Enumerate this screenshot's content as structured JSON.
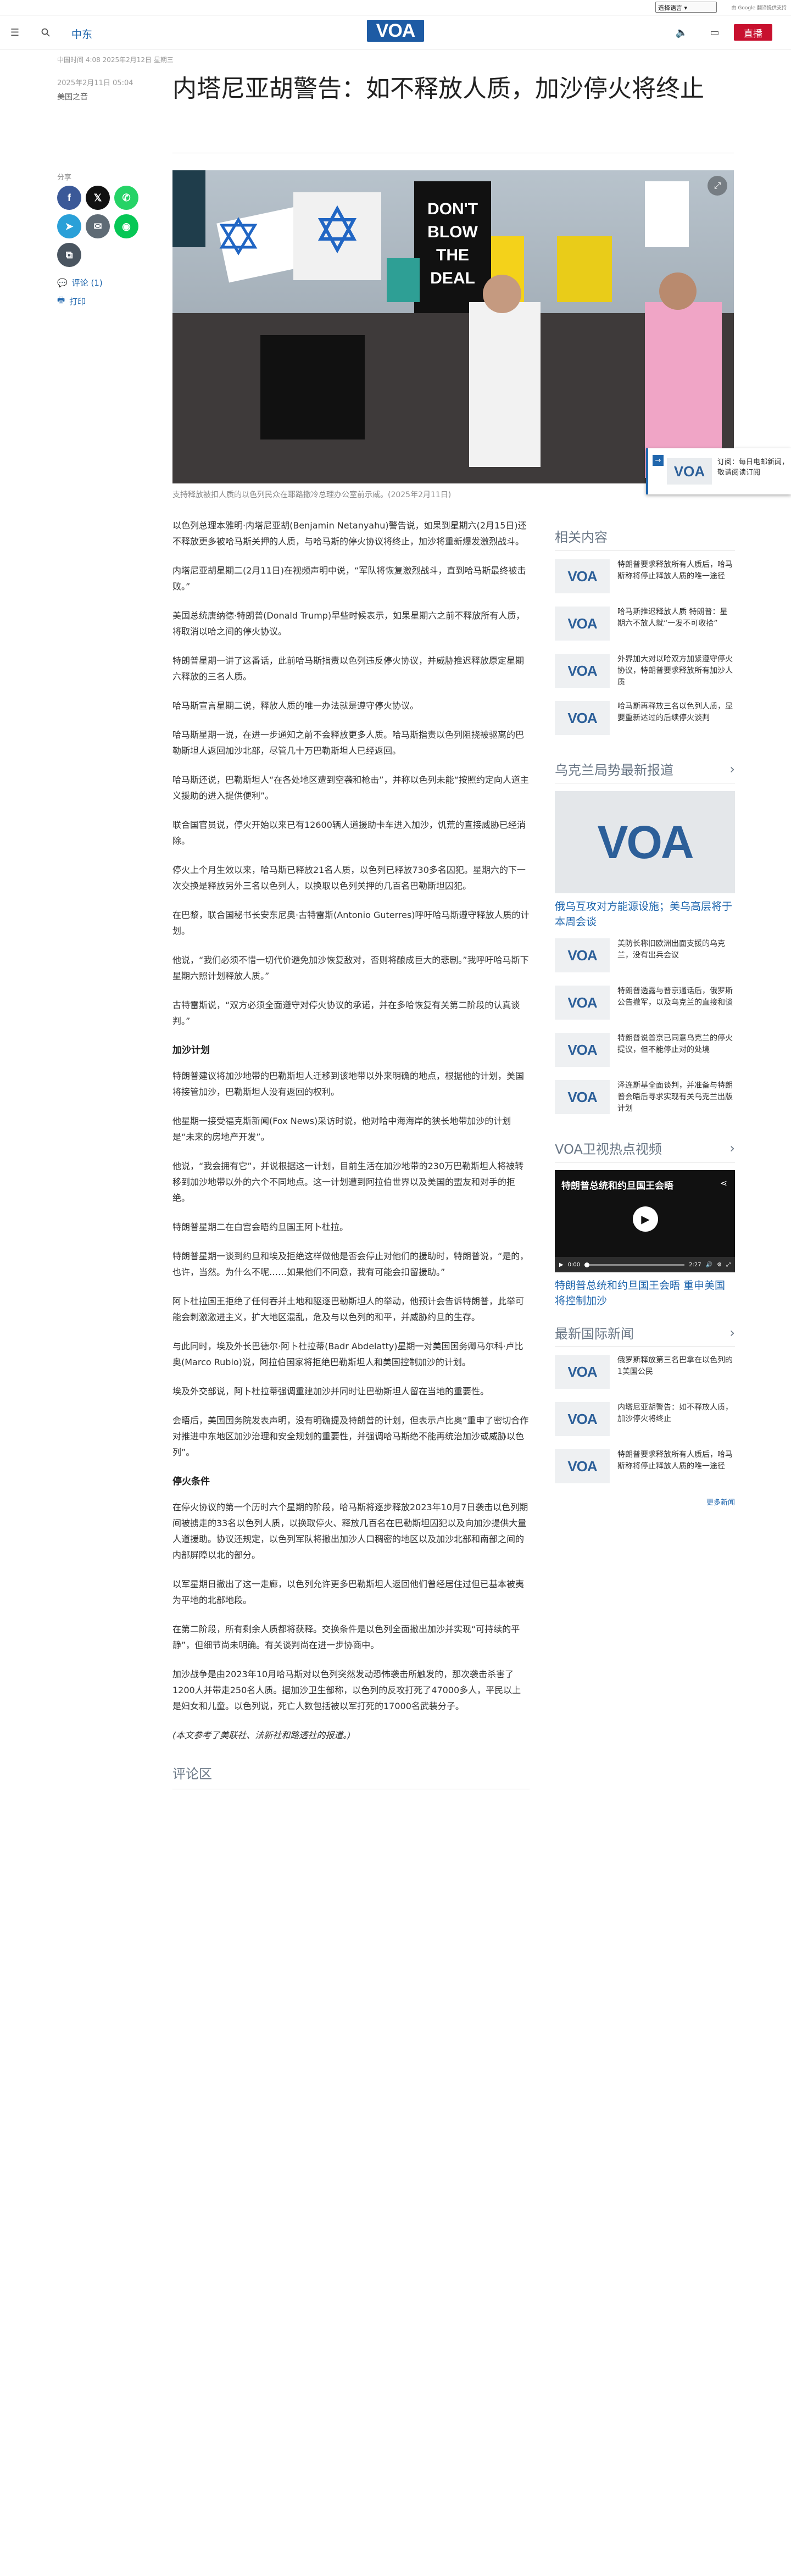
{
  "topbar": {
    "language_select": "选择语言",
    "translate_credit": "由 Google 翻译提供支持"
  },
  "header": {
    "section": "中东",
    "logo": "VOA",
    "live_label": "直播"
  },
  "article": {
    "meta_line": "中国时间 4:08 2025年2月12日 星期三",
    "date": "2025年2月11日 05:04",
    "author": "美国之音",
    "title": "内塔尼亚胡警告：如不释放人质，加沙停火将终止",
    "share_label": "分享",
    "comments_label": "评论 (1)",
    "print_label": "打印",
    "image_texts": {
      "sign1": "DON'T BLOW THE DEAL"
    },
    "caption": "支持释放被扣人质的以色列民众在耶路撒冷总理办公室前示威。(2025年2月11日)",
    "paragraphs": [
      "以色列总理本雅明·内塔尼亚胡(Benjamin Netanyahu)警告说，如果到星期六(2月15日)还不释放更多被哈马斯关押的人质，与哈马斯的停火协议将终止，加沙将重新爆发激烈战斗。",
      "内塔尼亚胡星期二(2月11日)在视频声明中说，“军队将恢复激烈战斗，直到哈马斯最终被击败。”",
      "美国总统唐纳德·特朗普(Donald Trump)早些时候表示，如果星期六之前不释放所有人质，将取消以哈之间的停火协议。",
      "特朗普星期一讲了这番话，此前哈马斯指责以色列违反停火协议，并威胁推迟释放原定星期六释放的三名人质。",
      "哈马斯宣言星期二说，释放人质的唯一办法就是遵守停火协议。",
      "哈马斯星期一说，在进一步通知之前不会释放更多人质。哈马斯指责以色列阻挠被驱离的巴勒斯坦人返回加沙北部，尽管几十万巴勒斯坦人已经返回。",
      "哈马斯还说，巴勒斯坦人“在各处地区遭到空袭和枪击”，并称以色列未能“按照约定向人道主义援助的进入提供便利”。",
      "联合国官员说，停火开始以来已有12600辆人道援助卡车进入加沙，饥荒的直接威胁已经消除。",
      "停火上个月生效以来，哈马斯已释放21名人质，以色列已释放730多名囚犯。星期六的下一次交换是释放另外三名以色列人，以换取以色列关押的几百名巴勒斯坦囚犯。",
      "在巴黎，联合国秘书长安东尼奥·古特雷斯(Antonio Guterres)呼吁哈马斯遵守释放人质的计划。",
      "他说，“我们必须不惜一切代价避免加沙恢复敌对，否则将酿成巨大的悲剧。”我呼吁哈马斯下星期六照计划释放人质。”",
      "古特雷斯说，“双方必须全面遵守对停火协议的承诺，并在多哈恢复有关第二阶段的认真谈判。”"
    ],
    "subhead1": "加沙计划",
    "paragraphs2": [
      "特朗普建议将加沙地带的巴勒斯坦人迁移到该地带以外来明确的地点，根据他的计划，美国将接管加沙，巴勒斯坦人没有返回的权利。",
      "他星期一接受福克斯新闻(Fox News)采访时说，他对哈中海海岸的狭长地带加沙的计划是“未来的房地产开发”。",
      "他说，“我会拥有它”，并说根据这一计划，目前生活在加沙地带的230万巴勒斯坦人将被转移到加沙地带以外的六个不同地点。这一计划遭到阿拉伯世界以及美国的盟友和对手的拒绝。",
      "特朗普星期二在白宫会晤约旦国王阿卜杜拉。",
      "特朗普星期一谈到约旦和埃及拒绝这样做他是否会停止对他们的援助时，特朗普说，“是的，也许，当然。为什么不呢……如果他们不同意，我有可能会扣留援助。”",
      "阿卜杜拉国王拒绝了任何吞并土地和驱逐巴勒斯坦人的举动，他预计会告诉特朗普，此举可能会刺激激进主义，扩大地区混乱，危及与以色列的和平，并威胁约旦的生存。",
      "与此同时，埃及外长巴德尔·阿卜杜拉蒂(Badr Abdelatty)星期一对美国国务卿马尔科·卢比奥(Marco Rubio)说，阿拉伯国家将拒绝巴勒斯坦人和美国控制加沙的计划。",
      "埃及外交部说，阿卜杜拉蒂强调重建加沙并同时让巴勒斯坦人留在当地的重要性。",
      "会晤后，美国国务院发表声明，没有明确提及特朗普的计划，但表示卢比奥“重申了密切合作对推进中东地区加沙治理和安全规划的重要性，并强调哈马斯绝不能再统治加沙或威胁以色列”。"
    ],
    "subhead2": "停火条件",
    "paragraphs3": [
      "在停火协议的第一个历时六个星期的阶段，哈马斯将逐步释放2023年10月7日袭击以色列期间被掳走的33名以色列人质，以换取停火、释放几百名在巴勒斯坦囚犯以及向加沙提供大量人道援助。协议还规定，以色列军队将撤出加沙人口稠密的地区以及加沙北部和南部之间的内部屏障以北的部分。",
      "以军星期日撤出了这一走廊，以色列允许更多巴勒斯坦人返回他们曾经居住过但已基本被夷为平地的北部地段。",
      "在第二阶段，所有剩余人质都将获释。交换条件是以色列全面撤出加沙并实现“可持续的平静”，但细节尚未明确。有关谈判尚在进一步协商中。",
      "加沙战争是由2023年10月哈马斯对以色列突然发动恐怖袭击所触发的，那次袭击杀害了1200人并带走250名人质。据加沙卫生部称，以色列的反攻打死了47000多人，平民以上是妇女和儿童。以色列说，死亡人数包括被以军打死的17000名武装分子。"
    ],
    "source_note": "(本文参考了美联社、法新社和路透社的报道。)",
    "comments_heading": "评论区"
  },
  "rail": {
    "related_heading": "相关内容",
    "related": [
      "特朗普要求释放所有人质后，哈马斯称将停止释放人质的唯一途径",
      "哈马斯推迟释放人质 特朗普：星期六不放人就“一发不可收拾”",
      "外界加大对以哈双方加紧遵守停火协议，特朗普要求释放所有加沙人质",
      "哈马斯再释放三名以色列人质，显要重新达过的后续停火谈判"
    ],
    "ukraine_heading": "乌克兰局势最新报道",
    "ukraine_feature": "俄乌互攻对方能源设施；美乌高层将于本周会谈",
    "ukraine": [
      "美防长称旧欧洲出面支援的乌克兰，没有出兵会议",
      "特朗普透露与普京通话后，俄罗斯公告撤军，以及乌克兰的直接和谈",
      "特朗普说普京已同意乌克兰的停火提议，但不能停止对的处境",
      "泽连斯基全面谈判，并准备与特朗普会晤后寻求实现有关乌克兰出版计划"
    ],
    "video_heading": "VOA卫视热点视频",
    "video_title": "特朗普总统和约旦国王会晤",
    "video_time_current": "0:00",
    "video_time_total": "2:27",
    "video_caption": "特朗普总统和约旦国王会晤 重申美国将控制加沙",
    "intl_heading": "最新国际新闻",
    "intl": [
      "俄罗斯释放第三名巴拿在以色列的1美国公民",
      "内塔尼亚胡警告：如不释放人质，加沙停火将终止",
      "特朗普要求释放所有人质后，哈马斯称将停止释放人质的唯一途径"
    ],
    "more_label": "更多新闻"
  },
  "popup": {
    "title": "订阅：每日电邮新闻，敬请阅读订阅",
    "logo": "VOA"
  },
  "colors": {
    "accent": "#1f66ad",
    "live": "#c8102e",
    "logo_blue": "#1d5ba4"
  }
}
